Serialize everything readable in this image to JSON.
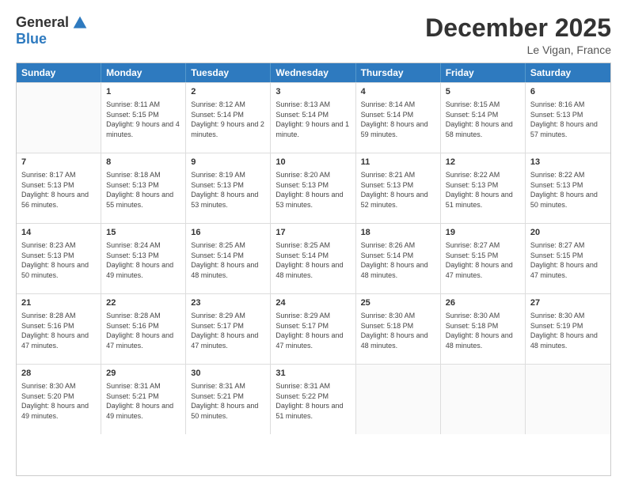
{
  "logo": {
    "general": "General",
    "blue": "Blue"
  },
  "header": {
    "month": "December 2025",
    "location": "Le Vigan, France"
  },
  "weekdays": [
    "Sunday",
    "Monday",
    "Tuesday",
    "Wednesday",
    "Thursday",
    "Friday",
    "Saturday"
  ],
  "weeks": [
    [
      {
        "day": "",
        "empty": true
      },
      {
        "day": "1",
        "sunrise": "Sunrise: 8:11 AM",
        "sunset": "Sunset: 5:15 PM",
        "daylight": "Daylight: 9 hours and 4 minutes."
      },
      {
        "day": "2",
        "sunrise": "Sunrise: 8:12 AM",
        "sunset": "Sunset: 5:14 PM",
        "daylight": "Daylight: 9 hours and 2 minutes."
      },
      {
        "day": "3",
        "sunrise": "Sunrise: 8:13 AM",
        "sunset": "Sunset: 5:14 PM",
        "daylight": "Daylight: 9 hours and 1 minute."
      },
      {
        "day": "4",
        "sunrise": "Sunrise: 8:14 AM",
        "sunset": "Sunset: 5:14 PM",
        "daylight": "Daylight: 8 hours and 59 minutes."
      },
      {
        "day": "5",
        "sunrise": "Sunrise: 8:15 AM",
        "sunset": "Sunset: 5:14 PM",
        "daylight": "Daylight: 8 hours and 58 minutes."
      },
      {
        "day": "6",
        "sunrise": "Sunrise: 8:16 AM",
        "sunset": "Sunset: 5:13 PM",
        "daylight": "Daylight: 8 hours and 57 minutes."
      }
    ],
    [
      {
        "day": "7",
        "sunrise": "Sunrise: 8:17 AM",
        "sunset": "Sunset: 5:13 PM",
        "daylight": "Daylight: 8 hours and 56 minutes."
      },
      {
        "day": "8",
        "sunrise": "Sunrise: 8:18 AM",
        "sunset": "Sunset: 5:13 PM",
        "daylight": "Daylight: 8 hours and 55 minutes."
      },
      {
        "day": "9",
        "sunrise": "Sunrise: 8:19 AM",
        "sunset": "Sunset: 5:13 PM",
        "daylight": "Daylight: 8 hours and 53 minutes."
      },
      {
        "day": "10",
        "sunrise": "Sunrise: 8:20 AM",
        "sunset": "Sunset: 5:13 PM",
        "daylight": "Daylight: 8 hours and 53 minutes."
      },
      {
        "day": "11",
        "sunrise": "Sunrise: 8:21 AM",
        "sunset": "Sunset: 5:13 PM",
        "daylight": "Daylight: 8 hours and 52 minutes."
      },
      {
        "day": "12",
        "sunrise": "Sunrise: 8:22 AM",
        "sunset": "Sunset: 5:13 PM",
        "daylight": "Daylight: 8 hours and 51 minutes."
      },
      {
        "day": "13",
        "sunrise": "Sunrise: 8:22 AM",
        "sunset": "Sunset: 5:13 PM",
        "daylight": "Daylight: 8 hours and 50 minutes."
      }
    ],
    [
      {
        "day": "14",
        "sunrise": "Sunrise: 8:23 AM",
        "sunset": "Sunset: 5:13 PM",
        "daylight": "Daylight: 8 hours and 50 minutes."
      },
      {
        "day": "15",
        "sunrise": "Sunrise: 8:24 AM",
        "sunset": "Sunset: 5:13 PM",
        "daylight": "Daylight: 8 hours and 49 minutes."
      },
      {
        "day": "16",
        "sunrise": "Sunrise: 8:25 AM",
        "sunset": "Sunset: 5:14 PM",
        "daylight": "Daylight: 8 hours and 48 minutes."
      },
      {
        "day": "17",
        "sunrise": "Sunrise: 8:25 AM",
        "sunset": "Sunset: 5:14 PM",
        "daylight": "Daylight: 8 hours and 48 minutes."
      },
      {
        "day": "18",
        "sunrise": "Sunrise: 8:26 AM",
        "sunset": "Sunset: 5:14 PM",
        "daylight": "Daylight: 8 hours and 48 minutes."
      },
      {
        "day": "19",
        "sunrise": "Sunrise: 8:27 AM",
        "sunset": "Sunset: 5:15 PM",
        "daylight": "Daylight: 8 hours and 47 minutes."
      },
      {
        "day": "20",
        "sunrise": "Sunrise: 8:27 AM",
        "sunset": "Sunset: 5:15 PM",
        "daylight": "Daylight: 8 hours and 47 minutes."
      }
    ],
    [
      {
        "day": "21",
        "sunrise": "Sunrise: 8:28 AM",
        "sunset": "Sunset: 5:16 PM",
        "daylight": "Daylight: 8 hours and 47 minutes."
      },
      {
        "day": "22",
        "sunrise": "Sunrise: 8:28 AM",
        "sunset": "Sunset: 5:16 PM",
        "daylight": "Daylight: 8 hours and 47 minutes."
      },
      {
        "day": "23",
        "sunrise": "Sunrise: 8:29 AM",
        "sunset": "Sunset: 5:17 PM",
        "daylight": "Daylight: 8 hours and 47 minutes."
      },
      {
        "day": "24",
        "sunrise": "Sunrise: 8:29 AM",
        "sunset": "Sunset: 5:17 PM",
        "daylight": "Daylight: 8 hours and 47 minutes."
      },
      {
        "day": "25",
        "sunrise": "Sunrise: 8:30 AM",
        "sunset": "Sunset: 5:18 PM",
        "daylight": "Daylight: 8 hours and 48 minutes."
      },
      {
        "day": "26",
        "sunrise": "Sunrise: 8:30 AM",
        "sunset": "Sunset: 5:18 PM",
        "daylight": "Daylight: 8 hours and 48 minutes."
      },
      {
        "day": "27",
        "sunrise": "Sunrise: 8:30 AM",
        "sunset": "Sunset: 5:19 PM",
        "daylight": "Daylight: 8 hours and 48 minutes."
      }
    ],
    [
      {
        "day": "28",
        "sunrise": "Sunrise: 8:30 AM",
        "sunset": "Sunset: 5:20 PM",
        "daylight": "Daylight: 8 hours and 49 minutes."
      },
      {
        "day": "29",
        "sunrise": "Sunrise: 8:31 AM",
        "sunset": "Sunset: 5:21 PM",
        "daylight": "Daylight: 8 hours and 49 minutes."
      },
      {
        "day": "30",
        "sunrise": "Sunrise: 8:31 AM",
        "sunset": "Sunset: 5:21 PM",
        "daylight": "Daylight: 8 hours and 50 minutes."
      },
      {
        "day": "31",
        "sunrise": "Sunrise: 8:31 AM",
        "sunset": "Sunset: 5:22 PM",
        "daylight": "Daylight: 8 hours and 51 minutes."
      },
      {
        "day": "",
        "empty": true
      },
      {
        "day": "",
        "empty": true
      },
      {
        "day": "",
        "empty": true
      }
    ]
  ]
}
